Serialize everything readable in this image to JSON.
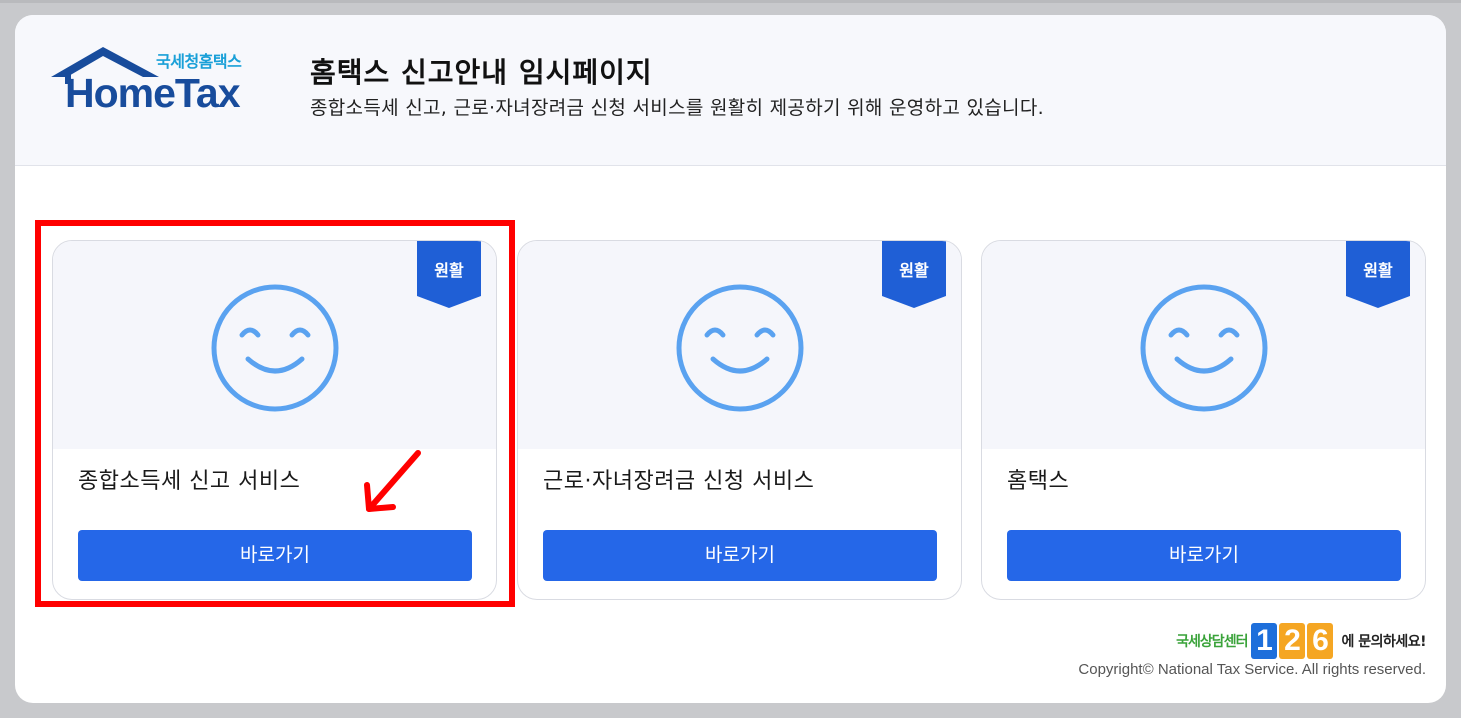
{
  "header": {
    "logo_kr": "국세청홈택스",
    "logo_en": "HomeTax",
    "title": "홈택스 신고안내 임시페이지",
    "subtitle": "종합소득세 신고, 근로·자녀장려금 신청 서비스를 원활히 제공하기 위해 운영하고 있습니다."
  },
  "cards": [
    {
      "title": "종합소득세 신고 서비스",
      "status": "원활",
      "button": "바로가기",
      "icon": "smiley-icon"
    },
    {
      "title": "근로·자녀장려금 신청 서비스",
      "status": "원활",
      "button": "바로가기",
      "icon": "smiley-icon"
    },
    {
      "title": "홈택스",
      "status": "원활",
      "button": "바로가기",
      "icon": "smiley-icon"
    }
  ],
  "footer": {
    "callcenter_prefix": "국세상담센터",
    "callcenter_number": [
      "1",
      "2",
      "6"
    ],
    "callcenter_suffix": "에 문의하세요!",
    "copyright": "Copyright© National Tax Service. All rights reserved."
  },
  "colors": {
    "accent": "#2567e8",
    "ribbon": "#1f5fd6",
    "smiley": "#5aa2f0",
    "highlight": "#ff0000",
    "logo_blue": "#184c9c",
    "logo_cyan": "#1aa0d8",
    "digit_1": "#1e6fdb",
    "digit_2": "#f5a623",
    "digit_6": "#f5a623"
  }
}
